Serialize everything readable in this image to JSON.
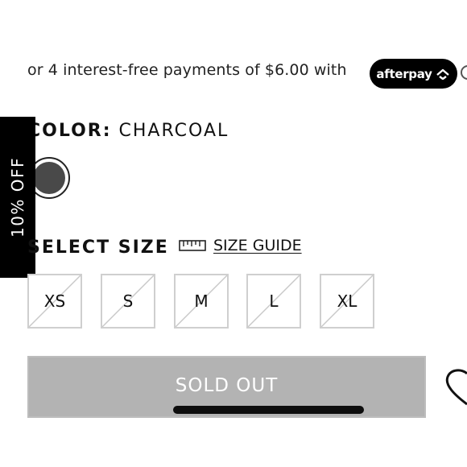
{
  "payments": {
    "text": "or 4 interest-free payments of $6.00 with",
    "provider_label": "afterpay",
    "provider_icon": "afterpay-arrows-icon",
    "info_icon": "info-icon"
  },
  "color": {
    "label": "COLOR:",
    "value": "CHARCOAL",
    "swatch_color": "#494949"
  },
  "promo_tab": {
    "label": "10% OFF"
  },
  "size": {
    "title": "SELECT SIZE",
    "guide_icon": "ruler-icon",
    "guide_label": "SIZE GUIDE",
    "options": [
      {
        "label": "XS",
        "available": false
      },
      {
        "label": "S",
        "available": false
      },
      {
        "label": "M",
        "available": false
      },
      {
        "label": "L",
        "available": false
      },
      {
        "label": "XL",
        "available": false
      }
    ]
  },
  "purchase": {
    "button_label": "SOLD OUT",
    "wishlist_icon": "heart-icon"
  },
  "colors": {
    "button_disabled": "#b3b3b3",
    "size_border": "#cfcfcf",
    "promo_bg": "#000000"
  }
}
